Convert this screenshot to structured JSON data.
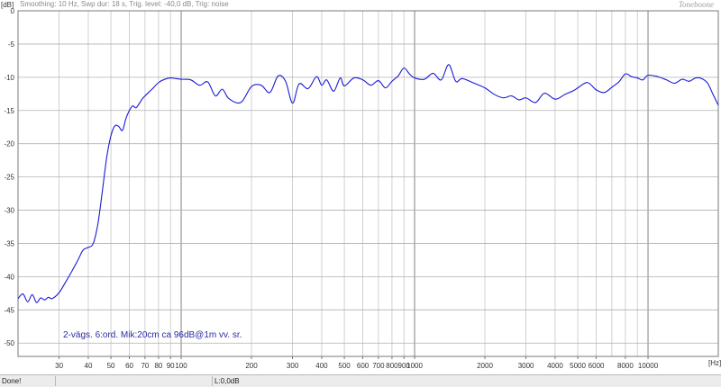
{
  "header": {
    "info": "Smoothing: 10 Hz, Swp dur: 18 s, Trig. level: -40,0 dB, Trig: noise",
    "brand": "Toneboone",
    "y_unit": "[dB]",
    "x_unit": "[Hz]"
  },
  "annotation": "2-vägs. 6:ord. Mik:20cm ca 96dB@1m vv. sr.",
  "status_bar": {
    "left": "Done!",
    "middle": "",
    "right": "L:0,0dB"
  },
  "colors": {
    "trace": "#1a1ad6",
    "grid": "#8c8c8c",
    "background": "#ffffff"
  },
  "chart_data": {
    "type": "line",
    "title": "",
    "xlabel": "[Hz]",
    "ylabel": "[dB]",
    "x_scale": "log",
    "xlim": [
      20,
      20000
    ],
    "ylim": [
      -52,
      0
    ],
    "x_ticks": [
      30,
      40,
      50,
      60,
      70,
      80,
      90,
      100,
      200,
      300,
      400,
      500,
      600,
      700,
      800,
      900,
      1000,
      2000,
      3000,
      4000,
      5000,
      6000,
      8000,
      10000
    ],
    "y_ticks": [
      0,
      -5,
      -10,
      -15,
      -20,
      -25,
      -30,
      -35,
      -40,
      -45,
      -50
    ],
    "grid": true,
    "series": [
      {
        "name": "",
        "x": [
          20,
          21,
          22,
          23,
          24,
          25,
          26,
          27,
          28,
          30,
          32,
          34,
          36,
          38,
          40,
          42,
          44,
          46,
          48,
          50,
          52,
          54,
          56,
          58,
          60,
          62,
          64,
          66,
          68,
          70,
          75,
          80,
          85,
          90,
          95,
          100,
          110,
          120,
          130,
          140,
          150,
          160,
          180,
          200,
          220,
          240,
          260,
          280,
          300,
          320,
          350,
          380,
          400,
          420,
          450,
          480,
          500,
          550,
          600,
          650,
          700,
          750,
          800,
          850,
          900,
          950,
          1000,
          1100,
          1200,
          1300,
          1400,
          1500,
          1600,
          1800,
          2000,
          2200,
          2400,
          2600,
          2800,
          3000,
          3300,
          3600,
          4000,
          4400,
          4800,
          5000,
          5500,
          6000,
          6500,
          7000,
          7500,
          8000,
          8500,
          9000,
          9500,
          10000,
          11000,
          12000,
          13000,
          14000,
          15000,
          16000,
          17000,
          18000,
          19000,
          20000
        ],
        "y": [
          -43.3,
          -42.6,
          -43.8,
          -42.7,
          -43.9,
          -43.2,
          -43.5,
          -43.1,
          -43.3,
          -42.4,
          -40.8,
          -39.2,
          -37.6,
          -36.0,
          -35.6,
          -35.0,
          -32.0,
          -27.0,
          -22.0,
          -18.8,
          -17.3,
          -17.4,
          -18.0,
          -16.2,
          -15.0,
          -14.3,
          -14.6,
          -14.0,
          -13.3,
          -12.8,
          -11.8,
          -10.8,
          -10.3,
          -10.1,
          -10.2,
          -10.3,
          -10.4,
          -11.2,
          -10.7,
          -12.8,
          -11.8,
          -13.2,
          -13.8,
          -11.4,
          -11.2,
          -12.3,
          -9.8,
          -10.6,
          -13.9,
          -11.0,
          -11.7,
          -9.9,
          -11.2,
          -10.4,
          -12.1,
          -10.1,
          -11.3,
          -10.1,
          -10.4,
          -11.2,
          -10.5,
          -11.6,
          -10.6,
          -9.8,
          -8.6,
          -9.5,
          -10.1,
          -10.3,
          -9.4,
          -10.4,
          -8.1,
          -10.6,
          -10.2,
          -10.9,
          -11.6,
          -12.6,
          -13.1,
          -12.8,
          -13.4,
          -13.1,
          -13.8,
          -12.4,
          -13.3,
          -12.6,
          -12.0,
          -11.6,
          -10.8,
          -11.9,
          -12.3,
          -11.5,
          -10.7,
          -9.5,
          -9.9,
          -10.1,
          -10.4,
          -9.7,
          -9.9,
          -10.4,
          -10.9,
          -10.3,
          -10.6,
          -10.1,
          -10.2,
          -10.9,
          -12.6,
          -14.2
        ]
      }
    ]
  }
}
